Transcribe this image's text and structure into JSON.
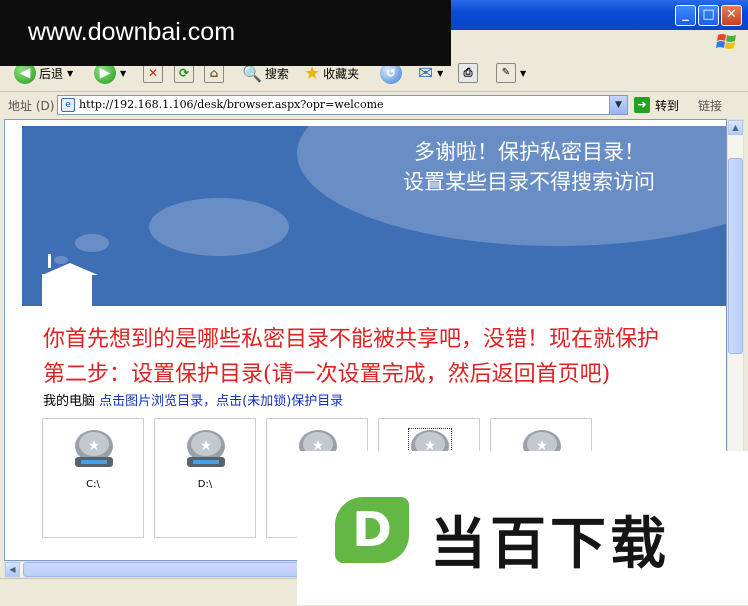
{
  "watermark": {
    "site": "www.downbai.com",
    "brand": "当百下载",
    "brand_mark": "D"
  },
  "window": {
    "min": "_",
    "max": "□",
    "close": "✕"
  },
  "toolbar": {
    "back_label": "后退",
    "search_label": "搜索",
    "favorites_label": "收藏夹"
  },
  "address": {
    "label": "地址 (D)",
    "url": "http://192.168.1.106/desk/browser.aspx?opr=welcome",
    "go_label": "转到",
    "links_label": "链接"
  },
  "banner": {
    "line1": "多谢啦！保护私密目录！",
    "line2": "设置某些目录不得搜索访问"
  },
  "content": {
    "intro": "你首先想到的是哪些私密目录不能被共享吧，没错！现在就保护",
    "step2": "第二步：设置保护目录(请一次设置完成，然后返回首页吧)",
    "breadcrumb_label": "我的电脑",
    "breadcrumb_link": "点击图片浏览目录，点击(未加锁)保护目录"
  },
  "drives": [
    {
      "label": "C:\\"
    },
    {
      "label": "D:\\"
    },
    {
      "label": ""
    },
    {
      "label": ""
    },
    {
      "label": ""
    }
  ]
}
